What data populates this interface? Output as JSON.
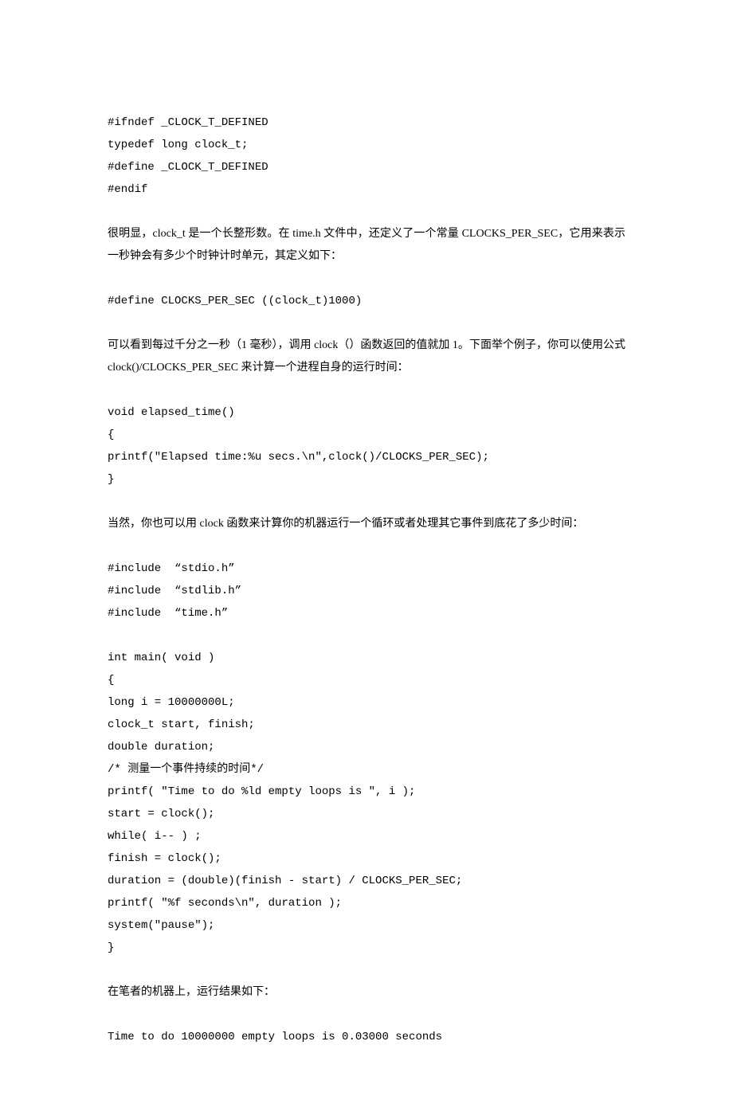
{
  "lines": {
    "c1": "#ifndef _CLOCK_T_DEFINED",
    "c2": "typedef long clock_t;",
    "c3": "#define _CLOCK_T_DEFINED",
    "c4": "#endif",
    "p1": "很明显，clock_t 是一个长整形数。在 time.h 文件中，还定义了一个常量 CLOCKS_PER_SEC，它用来表示一秒钟会有多少个时钟计时单元，其定义如下：",
    "c5": "#define CLOCKS_PER_SEC ((clock_t)1000)",
    "p2": "可以看到每过千分之一秒（1 毫秒），调用 clock（）函数返回的值就加 1。下面举个例子，你可以使用公式 clock()/CLOCKS_PER_SEC 来计算一个进程自身的运行时间：",
    "c6": "void elapsed_time()",
    "c7": "{",
    "c8": "printf(\"Elapsed time:%u secs.\\n\",clock()/CLOCKS_PER_SEC);",
    "c9": "}",
    "p3": "当然，你也可以用 clock 函数来计算你的机器运行一个循环或者处理其它事件到底花了多少时间：",
    "c10": "#include  “stdio.h”",
    "c11": "#include  “stdlib.h”",
    "c12": "#include  “time.h”",
    "c13": "int main( void )",
    "c14": "{",
    "c15": "long i = 10000000L;",
    "c16": "clock_t start, finish;",
    "c17": "double duration;",
    "c18": "/* 测量一个事件持续的时间*/",
    "c19": "printf( \"Time to do %ld empty loops is \", i );",
    "c20": "start = clock();",
    "c21": "while( i-- ) ;",
    "c22": "finish = clock();",
    "c23": "duration = (double)(finish - start) / CLOCKS_PER_SEC;",
    "c24": "printf( \"%f seconds\\n\", duration );",
    "c25": "system(\"pause\");",
    "c26": "}",
    "p4": "在笔者的机器上，运行结果如下：",
    "c27": "Time to do 10000000 empty loops is 0.03000 seconds"
  }
}
